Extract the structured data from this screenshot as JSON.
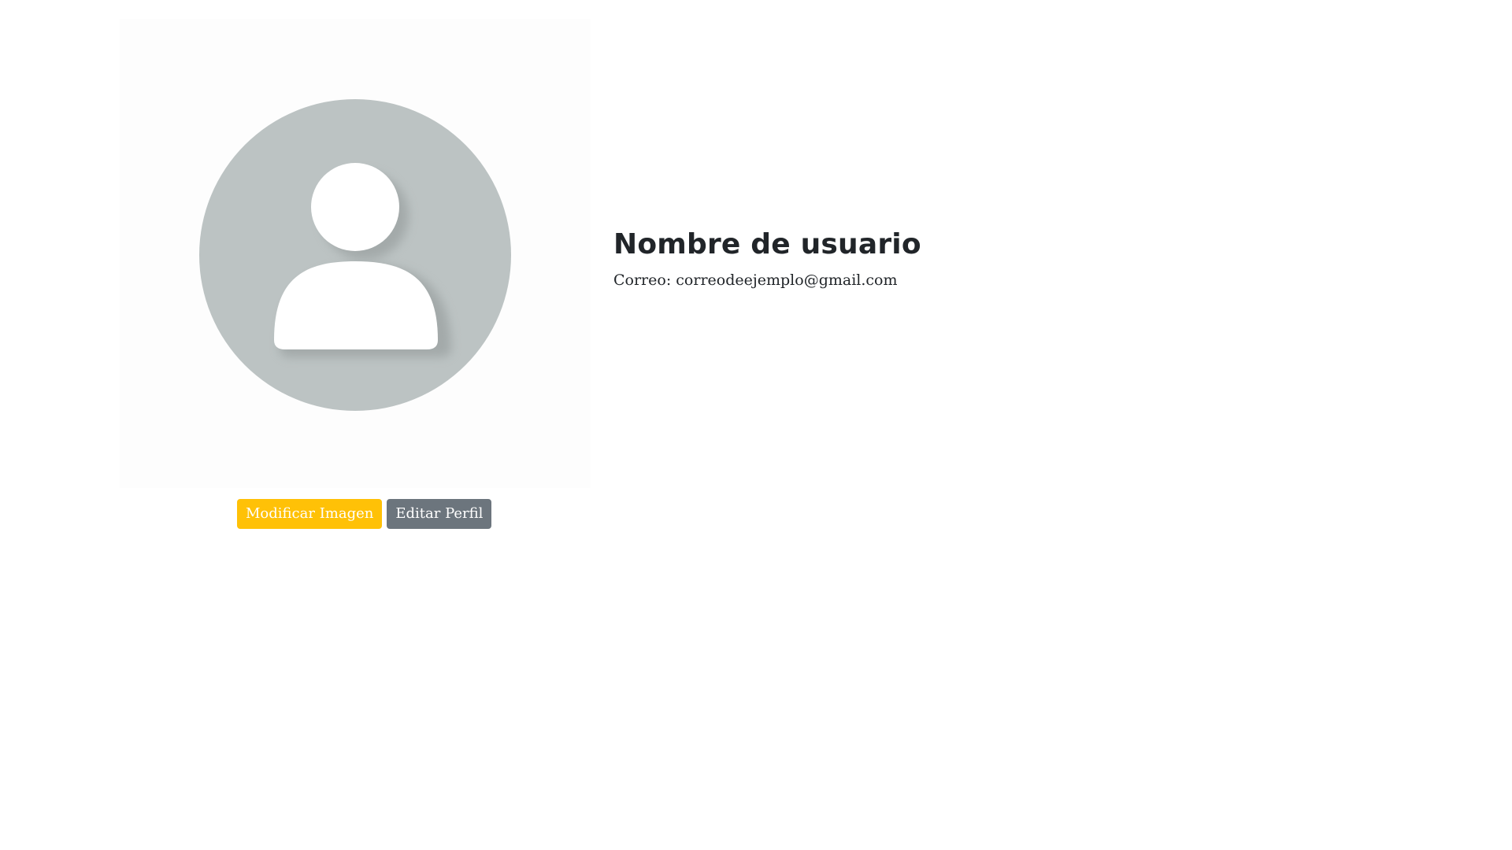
{
  "profile": {
    "avatar_icon": "user-avatar-placeholder-icon",
    "name": "Nombre de usuario",
    "email_label": "Correo:",
    "email_value": "correodeejemplo@gmail.com"
  },
  "actions": {
    "modify_image_label": "Modificar Imagen",
    "edit_profile_label": "Editar Perfil"
  },
  "colors": {
    "avatar_bg": "#bcc3c3",
    "warning": "#ffc107",
    "secondary": "#6c757d",
    "text": "#212529"
  }
}
